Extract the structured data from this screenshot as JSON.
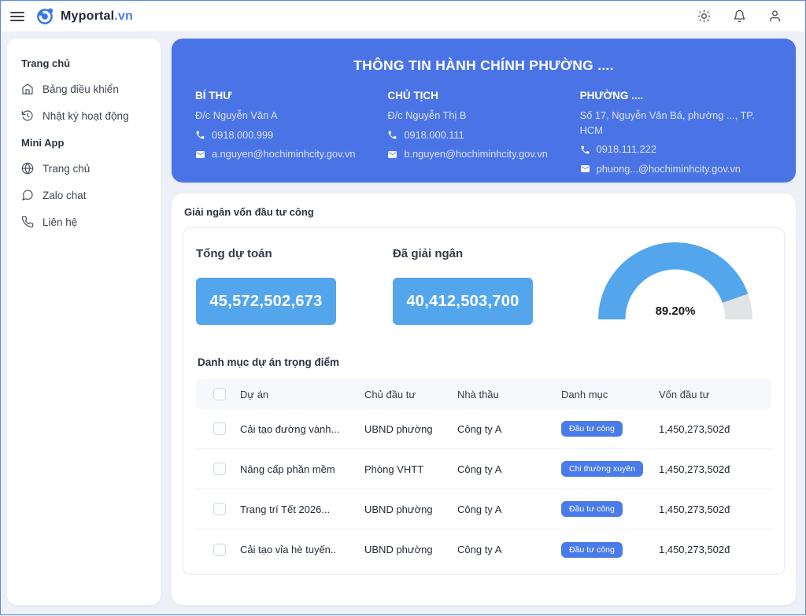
{
  "header": {
    "brand": "Myportal",
    "brand_suffix": ".vn",
    "icons": [
      "theme-toggle",
      "notifications",
      "profile"
    ]
  },
  "sidebar": {
    "sections": [
      {
        "label": "Trang chủ",
        "items": [
          {
            "icon": "home-icon",
            "label": "Bảng điều khiển"
          },
          {
            "icon": "history-icon",
            "label": "Nhật ký hoạt động"
          }
        ]
      },
      {
        "label": "Mini App",
        "items": [
          {
            "icon": "globe-icon",
            "label": "Trang chủ"
          },
          {
            "icon": "chat-icon",
            "label": "Zalo chat"
          },
          {
            "icon": "phone-icon",
            "label": "Liên hệ"
          }
        ]
      }
    ]
  },
  "info_card": {
    "title": "THÔNG TIN HÀNH CHÍNH PHƯỜNG ....",
    "columns": [
      {
        "role": "BÍ THƯ",
        "detail": "Đ/c Nguyễn Văn A",
        "phone": "0918.000.999",
        "email": "a.nguyen@hochiminhcity.gov.vn"
      },
      {
        "role": "CHỦ TỊCH",
        "detail": "Đ/c Nguyễn Thị B",
        "phone": "0918.000.111",
        "email": "b.nguyen@hochiminhcity.gov.vn"
      },
      {
        "role": "PHƯỜNG ....",
        "detail": "Số 17, Nguyễn Văn Bá, phường ..., TP. HCM",
        "phone": "0918.111.222",
        "email": "phuong...@hochiminhcity.gov.vn"
      }
    ]
  },
  "disbursement": {
    "section_title": "Giải ngân vốn đầu tư công",
    "total_label": "Tổng dự toán",
    "total_value": "45,572,502,673",
    "disbursed_label": "Đã giải ngân",
    "disbursed_value": "40,412,503,700",
    "gauge": {
      "percent": 89.2,
      "label": "89.20%"
    }
  },
  "projects": {
    "title": "Danh mục dự án trọng điểm",
    "columns": [
      "Dự án",
      "Chủ đầu tư",
      "Nhà thầu",
      "Danh mục",
      "Vốn đầu tư"
    ],
    "rows": [
      {
        "project": "Cải tạo đường vành...",
        "investor": "UBND phường",
        "contractor": "Công ty A",
        "category": "Đầu tư công",
        "capital": "1,450,273,502đ"
      },
      {
        "project": "Nâng cấp phần mềm",
        "investor": "Phòng VHTT",
        "contractor": "Công ty A",
        "category": "Chi thường xuyên",
        "capital": "1,450,273,502đ"
      },
      {
        "project": "Trang trí Tết 2026...",
        "investor": "UBND phường",
        "contractor": "Công ty A",
        "category": "Đầu tư công",
        "capital": "1,450,273,502đ"
      },
      {
        "project": "Cải tạo vỉa hè tuyến..",
        "investor": "UBND phường",
        "contractor": "Công ty A",
        "category": "Đầu tư công",
        "capital": "1,450,273,502đ"
      }
    ]
  },
  "colors": {
    "accent_blue": "#4a74e6",
    "sky_blue": "#54a6ec",
    "badge_blue": "#4a7bea",
    "gauge_rest": "#e2e3e5",
    "page_bg": "#edf0f7"
  }
}
